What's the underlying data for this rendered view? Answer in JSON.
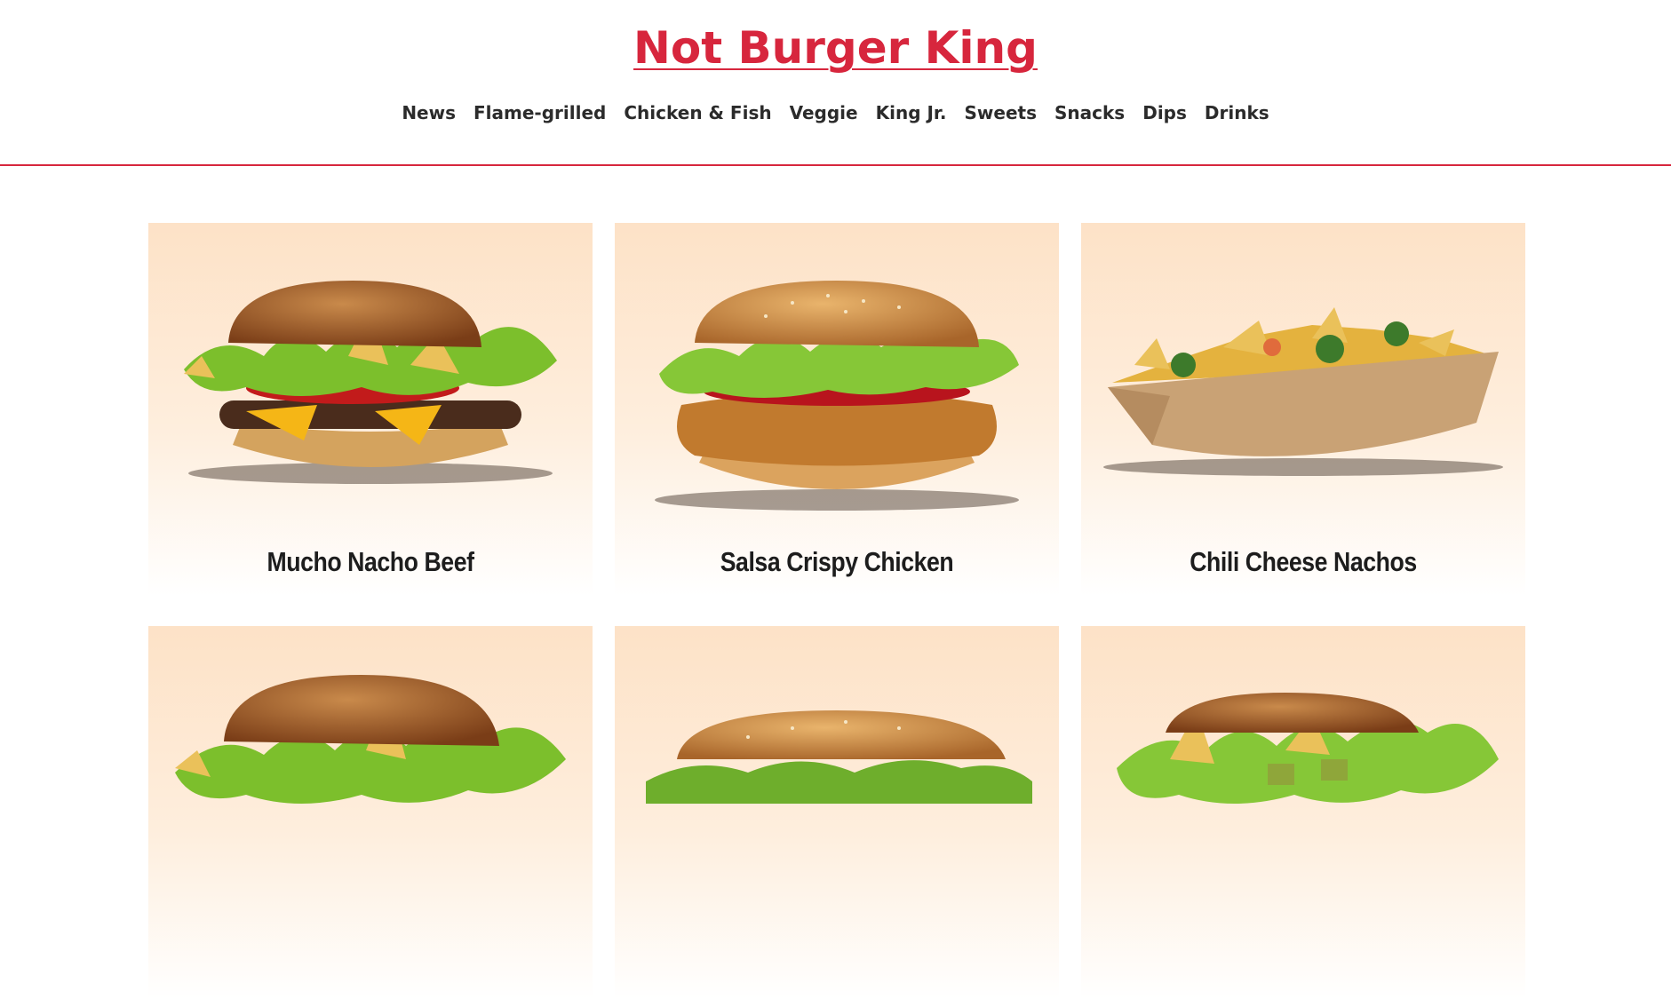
{
  "header": {
    "title": "Not Burger King",
    "nav": [
      "News",
      "Flame-grilled",
      "Chicken & Fish",
      "Veggie",
      "King Jr.",
      "Sweets",
      "Snacks",
      "Dips",
      "Drinks"
    ]
  },
  "products": [
    {
      "name": "Mucho Nacho Beef",
      "image_icon": "beef-burger-icon"
    },
    {
      "name": "Salsa Crispy Chicken",
      "image_icon": "chicken-burger-icon"
    },
    {
      "name": "Chili Cheese Nachos",
      "image_icon": "nachos-tray-icon"
    },
    {
      "name": "",
      "image_icon": "beef-burger-icon"
    },
    {
      "name": "",
      "image_icon": "long-burger-icon"
    },
    {
      "name": "",
      "image_icon": "veggie-burger-icon"
    }
  ],
  "colors": {
    "brand_red": "#d7263d",
    "card_peach": "#fde2c7",
    "text_dark": "#1d1d1d"
  }
}
